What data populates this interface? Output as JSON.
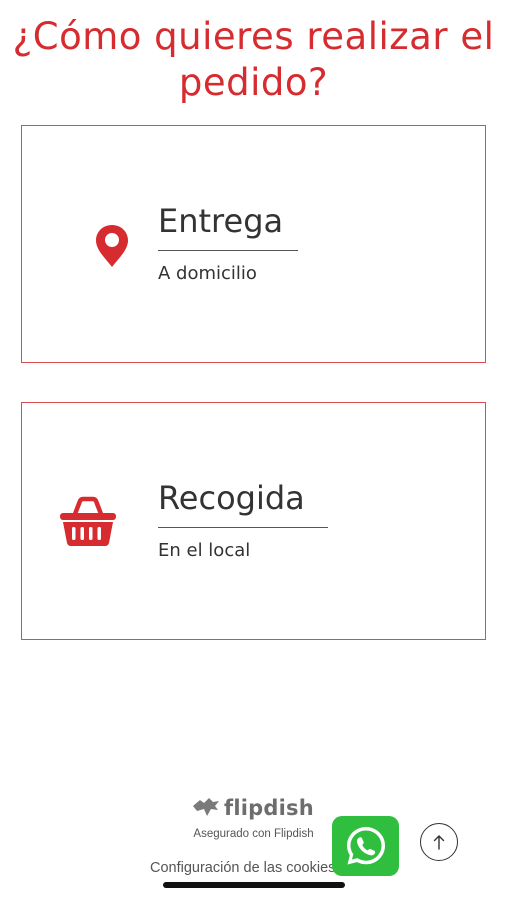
{
  "page": {
    "title": "¿Cómo quieres realizar el pedido?"
  },
  "options": {
    "delivery": {
      "label": "Entrega",
      "sublabel": "A domicilio",
      "icon": "map-pin-icon"
    },
    "pickup": {
      "label": "Recogida",
      "sublabel": "En el local",
      "icon": "shopping-basket-icon"
    }
  },
  "footer": {
    "brand_name": "flipdish",
    "brand_icon": "flipdish-logo-icon",
    "secured_text": "Asegurado con Flipdish",
    "cookies_link": "Configuración de las cookies",
    "whatsapp_icon": "whatsapp-icon",
    "scroll_top_icon": "arrow-up-icon"
  },
  "colors": {
    "accent": "#d62b2f",
    "card_border": "#d94c50",
    "whatsapp_green": "#2fbe3e",
    "text_dark": "#333333",
    "text_muted": "#6d6d6d"
  }
}
